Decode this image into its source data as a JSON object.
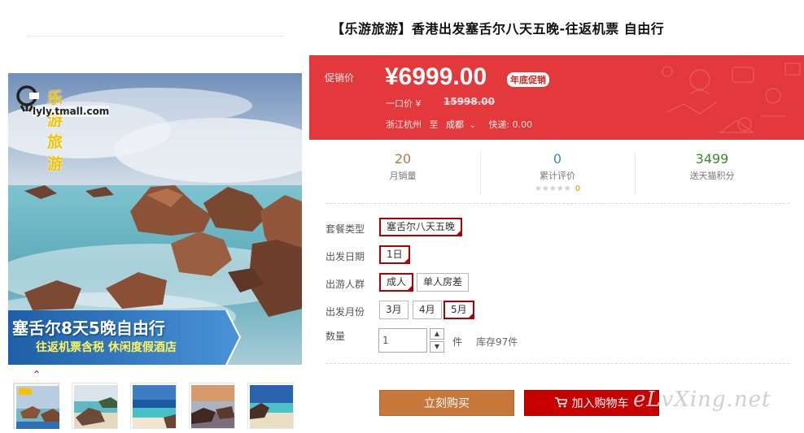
{
  "gallery": {
    "logo_text": "乐游旅游",
    "logo_url": "lyly.tmall.com",
    "banner_title": "塞舌尔8天5晚自由行",
    "banner_subtitle": "往返机票含税 休闲度假酒店",
    "thumbnail_count": 5,
    "selected_thumbnail": 0,
    "up_caret_icon": "chevron-up-icon"
  },
  "product": {
    "title": "【乐游旅游】香港出发塞舌尔八天五晚-往返机票 自由行"
  },
  "promo": {
    "label": "促销价",
    "price": "¥6999.00",
    "badge": "年底促销",
    "original_label": "一口价 ¥",
    "original_price": "15998.00",
    "origin": "浙江杭州",
    "to": "至",
    "destination": "成都",
    "shipping": "快递: 0.00",
    "bg_color": "#e4393c"
  },
  "stats": {
    "monthly_sales": {
      "value": "20",
      "label": "月销量",
      "color": "#b07a4f"
    },
    "reviews": {
      "value": "0",
      "label": "累计评价",
      "stars": "★★★★★",
      "count": "0",
      "color": "#3a8ec0"
    },
    "points": {
      "value": "3499",
      "label": "送天猫积分",
      "color": "#3a8a2a"
    }
  },
  "options": {
    "package": {
      "label": "套餐类型",
      "values": [
        "塞舌尔八天五晚"
      ]
    },
    "departure_date": {
      "label": "出发日期",
      "values": [
        "1日"
      ]
    },
    "travelers": {
      "label": "出游人群",
      "values": [
        "成人",
        "单人房差"
      ]
    },
    "month": {
      "label": "出发月份",
      "values": [
        "3月",
        "4月",
        "5月"
      ]
    }
  },
  "quantity": {
    "label": "数量",
    "value": "1",
    "unit": "件",
    "stock": "库存97件"
  },
  "actions": {
    "buy_now": "立刻购买",
    "add_to_cart": "加入购物车",
    "cart_icon": "cart-icon"
  },
  "watermark": "eLvXing.net"
}
